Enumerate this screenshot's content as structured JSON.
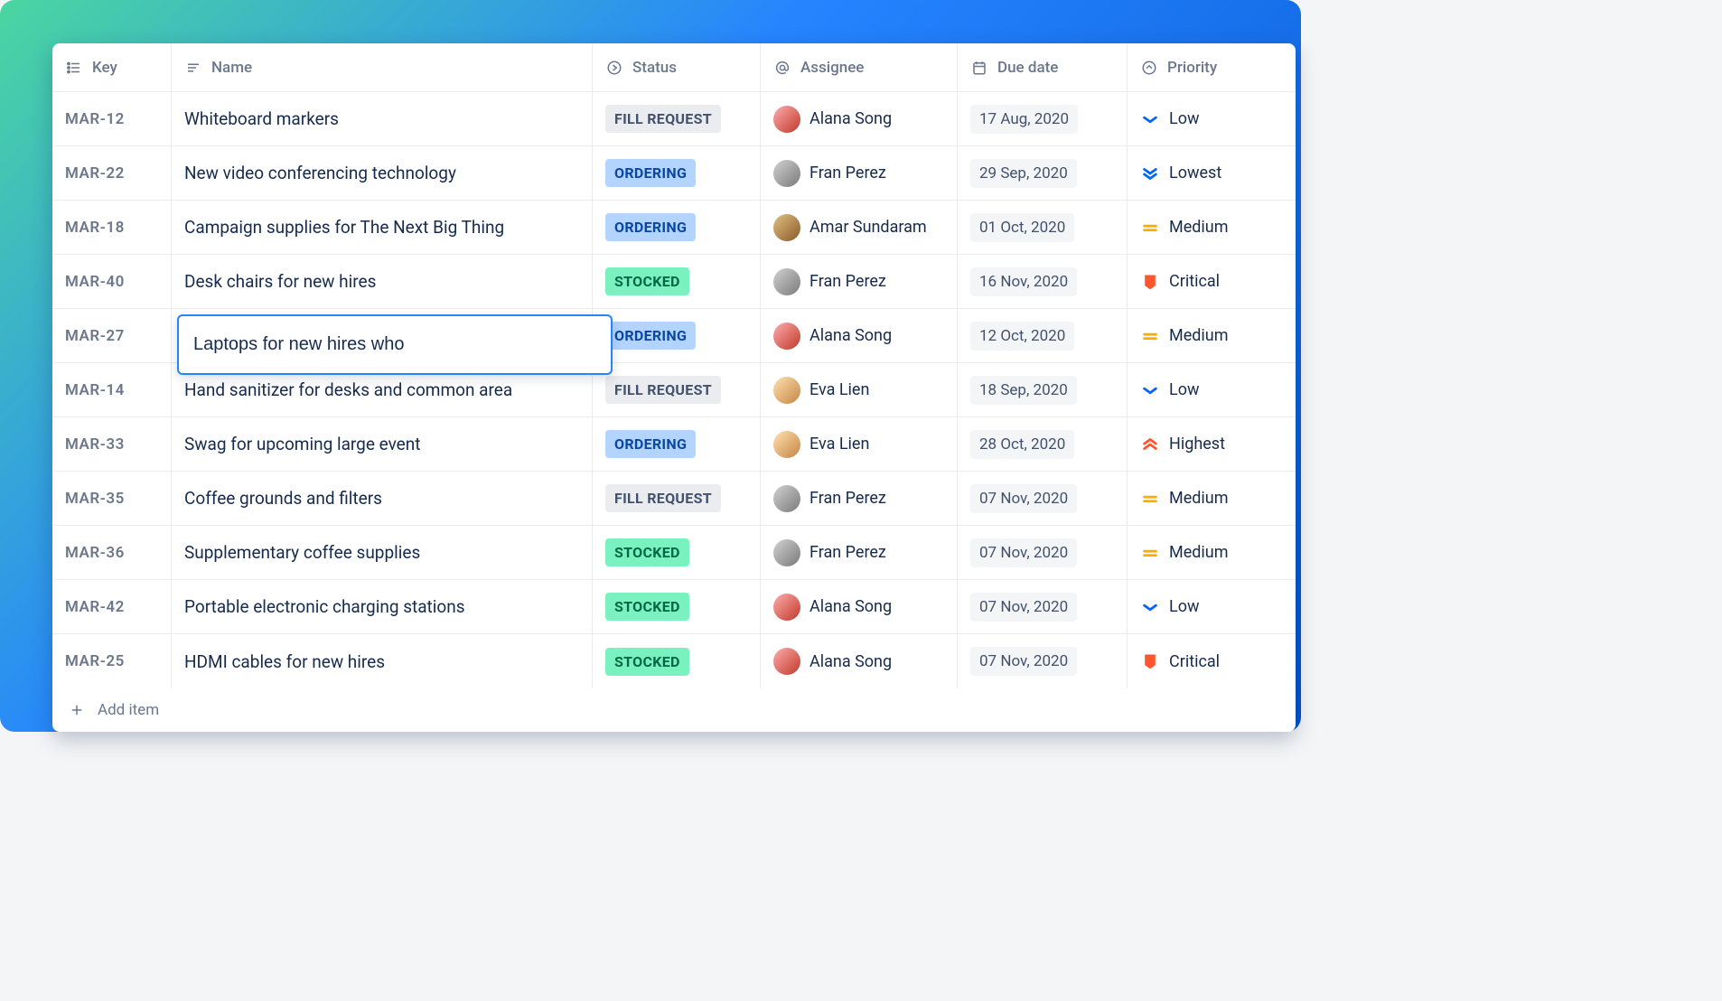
{
  "columns": {
    "key": "Key",
    "name": "Name",
    "status": "Status",
    "assignee": "Assignee",
    "due": "Due date",
    "priority": "Priority"
  },
  "statuses": {
    "fill": "FILL REQUEST",
    "ordering": "ORDERING",
    "stocked": "STOCKED"
  },
  "priorities": {
    "low": "Low",
    "lowest": "Lowest",
    "medium": "Medium",
    "critical": "Critical",
    "highest": "Highest"
  },
  "assignees": {
    "alana": {
      "name": "Alana Song",
      "avatar_bg": "linear-gradient(135deg,#ffadad,#c0392b)"
    },
    "fran": {
      "name": "Fran Perez",
      "avatar_bg": "linear-gradient(135deg,#d1d1d1,#7a7a7a)"
    },
    "amar": {
      "name": "Amar Sundaram",
      "avatar_bg": "linear-gradient(135deg,#e0c080,#8b5a2b)"
    },
    "eva": {
      "name": "Eva Lien",
      "avatar_bg": "linear-gradient(135deg,#ffe0b2,#c68642)"
    }
  },
  "rows": [
    {
      "key": "MAR-12",
      "name": "Whiteboard markers",
      "status": "fill",
      "assignee": "alana",
      "due": "17 Aug, 2020",
      "priority": "low"
    },
    {
      "key": "MAR-22",
      "name": "New video conferencing technology",
      "status": "ordering",
      "assignee": "fran",
      "due": "29 Sep, 2020",
      "priority": "lowest"
    },
    {
      "key": "MAR-18",
      "name": "Campaign supplies for The Next Big Thing",
      "status": "ordering",
      "assignee": "amar",
      "due": "01 Oct, 2020",
      "priority": "medium"
    },
    {
      "key": "MAR-40",
      "name": "Desk chairs for new hires",
      "status": "stocked",
      "assignee": "fran",
      "due": "16 Nov, 2020",
      "priority": "critical"
    },
    {
      "key": "MAR-27",
      "name": "Laptops for new hires who",
      "editing": true,
      "status": "ordering",
      "assignee": "alana",
      "due": "12 Oct, 2020",
      "priority": "medium"
    },
    {
      "key": "MAR-14",
      "name": "Hand sanitizer for desks and common area",
      "status": "fill",
      "assignee": "eva",
      "due": "18 Sep, 2020",
      "priority": "low"
    },
    {
      "key": "MAR-33",
      "name": "Swag for upcoming large event",
      "status": "ordering",
      "assignee": "eva",
      "due": "28 Oct, 2020",
      "priority": "highest"
    },
    {
      "key": "MAR-35",
      "name": "Coffee grounds and filters",
      "status": "fill",
      "assignee": "fran",
      "due": "07 Nov, 2020",
      "priority": "medium"
    },
    {
      "key": "MAR-36",
      "name": "Supplementary coffee supplies",
      "status": "stocked",
      "assignee": "fran",
      "due": "07 Nov, 2020",
      "priority": "medium"
    },
    {
      "key": "MAR-42",
      "name": "Portable electronic charging stations",
      "status": "stocked",
      "assignee": "alana",
      "due": "07 Nov, 2020",
      "priority": "low"
    },
    {
      "key": "MAR-25",
      "name": "HDMI cables for new hires",
      "status": "stocked",
      "assignee": "alana",
      "due": "07 Nov, 2020",
      "priority": "critical"
    }
  ],
  "add_item_label": "Add item"
}
